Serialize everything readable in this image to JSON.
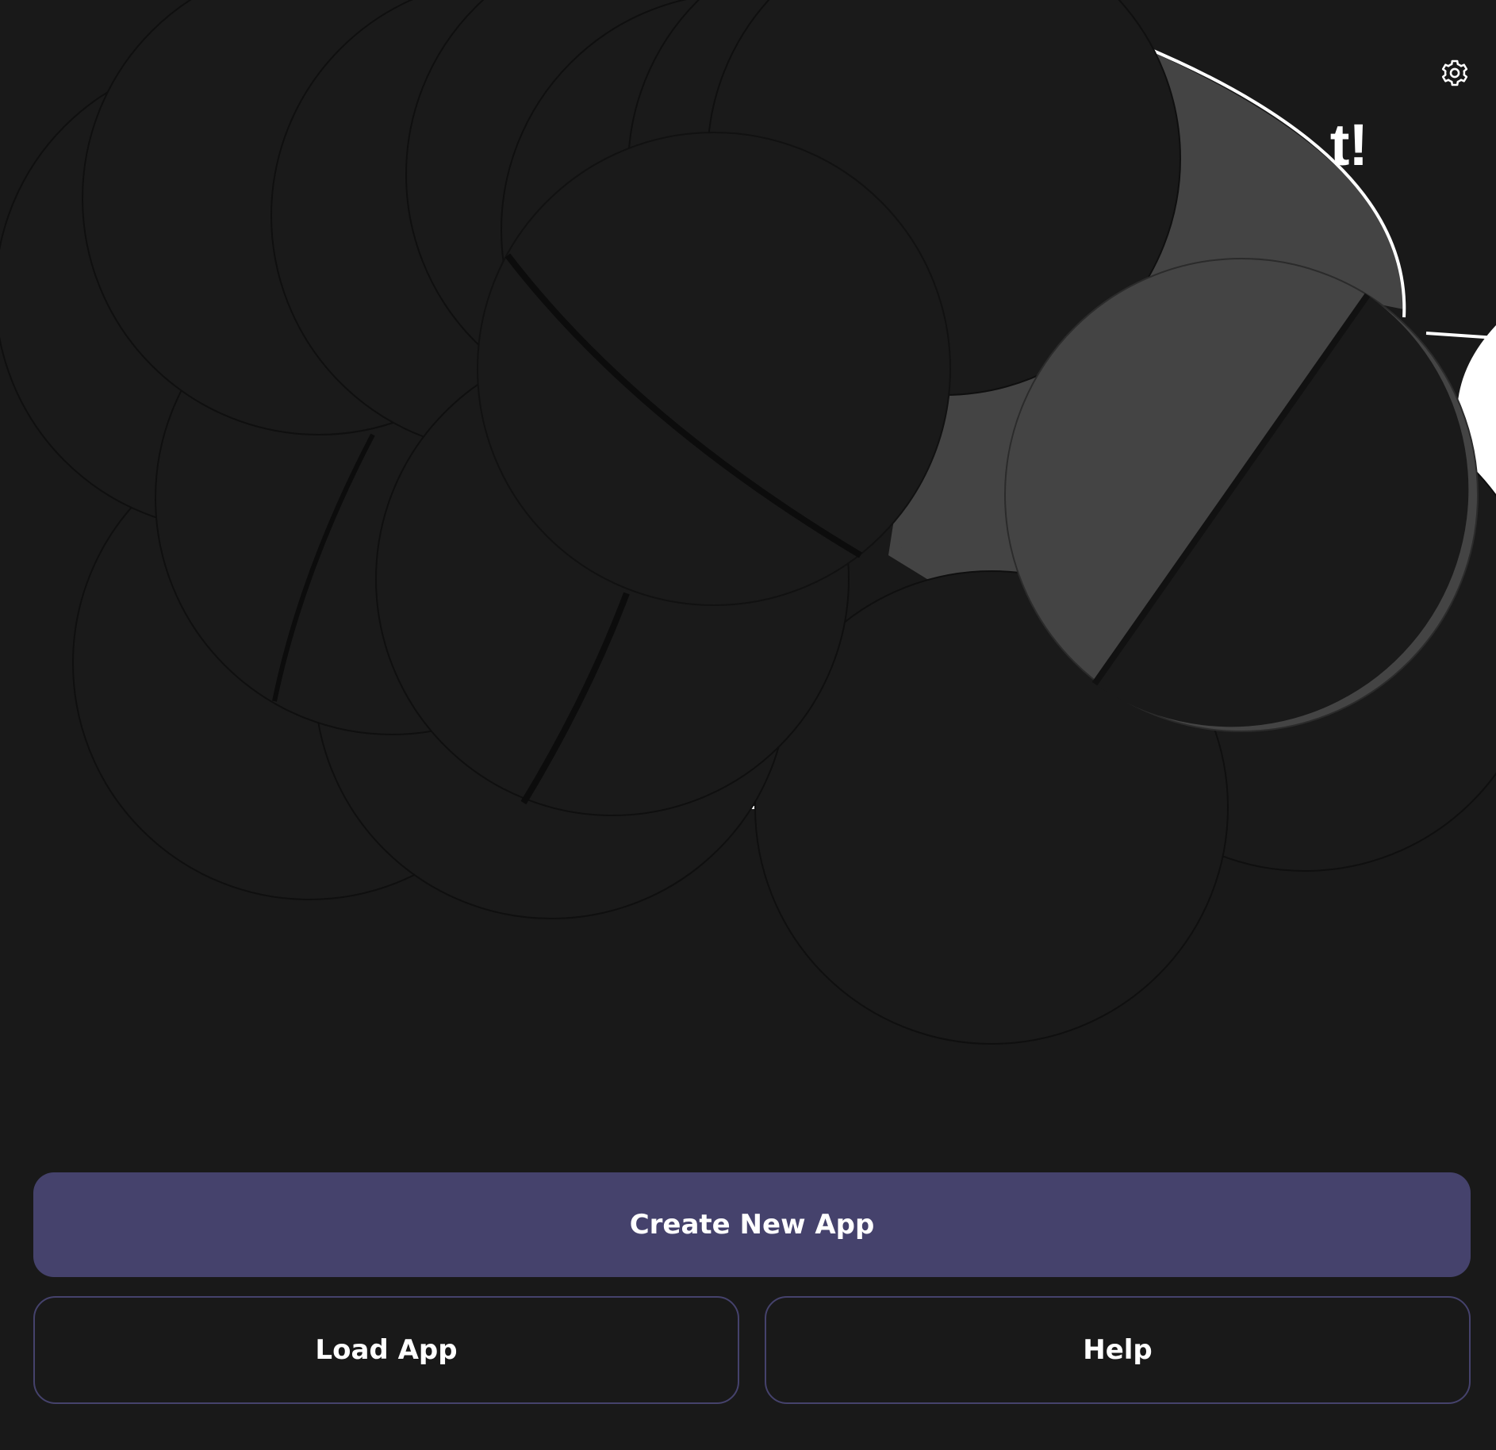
{
  "header": {
    "headline": "t!",
    "settings_icon": "gear-icon"
  },
  "actions": {
    "create_label": "Create New App",
    "load_label": "Load App",
    "help_label": "Help"
  },
  "colors": {
    "background": "#191919",
    "circle_fill": "#1a1a1a",
    "gray_fill": "#444444",
    "accent": "#45426c",
    "text": "#ffffff"
  }
}
